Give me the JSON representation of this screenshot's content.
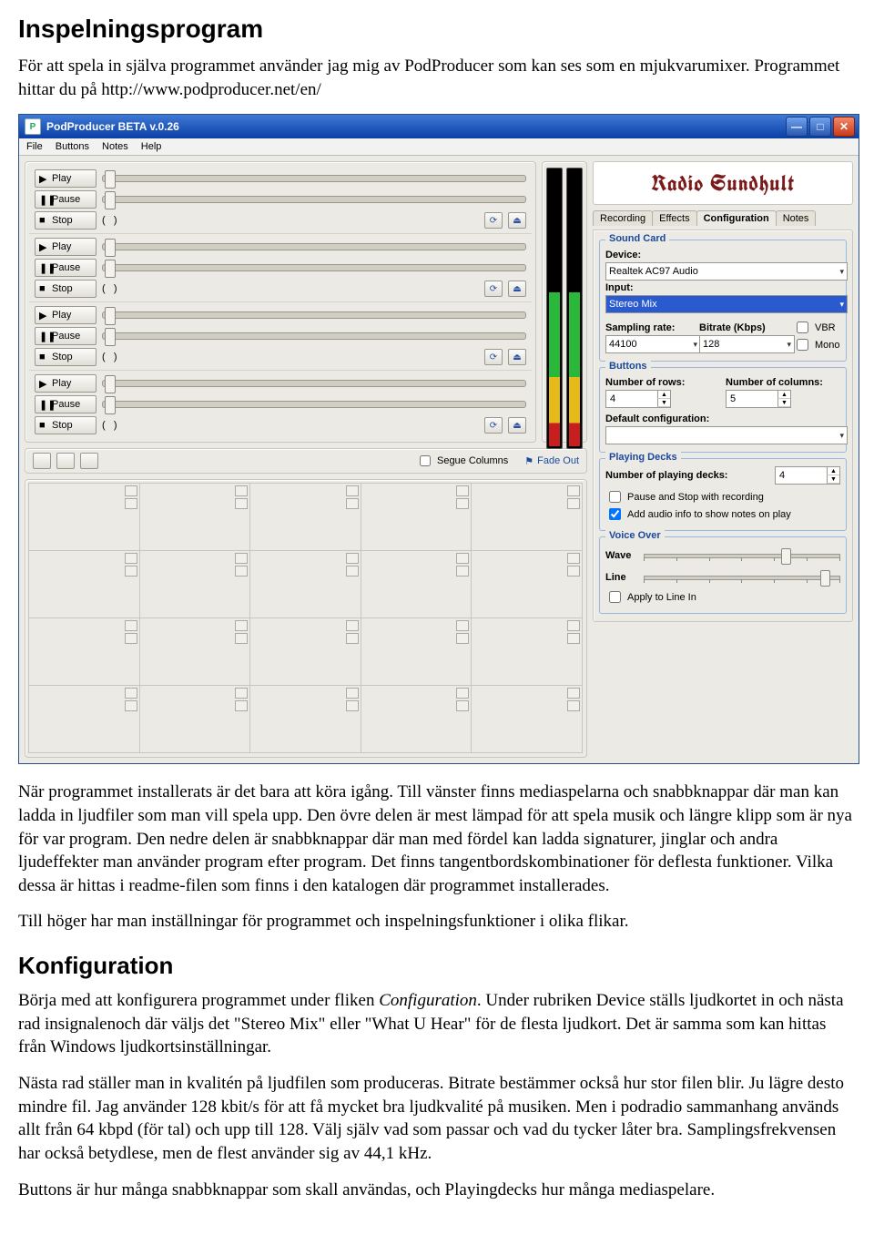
{
  "doc": {
    "h1": "Inspelningsprogram",
    "p1": "För att spela in själva programmet använder jag mig av PodProducer som kan ses som en mjukvarumixer. Programmet hittar du på http://www.podproducer.net/en/",
    "p2": "När programmet installerats är det bara att köra igång. Till vänster finns mediaspelarna och snabbknappar där man kan ladda in ljudfiler som man vill spela upp. Den övre delen är mest lämpad för att spela musik och längre klipp som är nya för var program. Den nedre delen är snabbknappar där man med fördel kan ladda signaturer, jinglar och andra ljudeffekter man använder program efter program. Det finns tangentbordskombinationer för deflesta funktioner. Vilka dessa är hittas i readme-filen som finns i den katalogen där programmet installerades.",
    "p3": "Till höger har man inställningar för programmet och inspelningsfunktioner i olika flikar.",
    "h2": "Konfiguration",
    "p4a": "Börja med att konfigurera programmet under fliken ",
    "p4b": "Configuration",
    "p4c": ". Under rubriken Device ställs ljudkortet in och nästa rad insignalenoch där väljs det \"Stereo Mix\" eller \"What U Hear\" för de flesta ljudkort. Det är samma som kan hittas från Windows ljudkortsinställningar.",
    "p5": "Nästa rad ställer man in kvalitén på ljudfilen som produceras. Bitrate bestämmer också hur stor filen blir. Ju lägre desto mindre fil. Jag använder 128 kbit/s för att få mycket bra ljudkvalité på musiken. Men i podradio sammanhang används allt från 64 kbpd (för tal) och upp till 128. Välj själv vad som passar och vad du tycker låter bra. Samplingsfrekvensen har också betydlese, men de flest använder sig av 44,1 kHz.",
    "p6": "Buttons är hur många snabbknappar som skall användas, och Playingdecks hur många mediaspelare."
  },
  "app": {
    "title": "PodProducer BETA v.0.26",
    "menu": [
      "File",
      "Buttons",
      "Notes",
      "Help"
    ],
    "deck_btns": {
      "play": "Play",
      "pause": "Pause",
      "stop": "Stop"
    },
    "toolbar2": {
      "segue": "Segue Columns",
      "fadeout": "Fade Out"
    },
    "right": {
      "logo": "Radio Sundhult",
      "tabs": [
        "Recording",
        "Effects",
        "Configuration",
        "Notes"
      ],
      "active_tab": 2,
      "sound_card": {
        "title": "Sound Card",
        "device_lbl": "Device:",
        "device_val": "Realtek AC97 Audio",
        "input_lbl": "Input:",
        "input_val": "Stereo Mix",
        "sampling_lbl": "Sampling rate:",
        "sampling_val": "44100",
        "bitrate_lbl": "Bitrate (Kbps)",
        "bitrate_val": "128",
        "vbr": "VBR",
        "mono": "Mono"
      },
      "buttons_grp": {
        "title": "Buttons",
        "rows_lbl": "Number of rows:",
        "rows_val": "4",
        "cols_lbl": "Number of columns:",
        "cols_val": "5",
        "def_lbl": "Default configuration:",
        "def_val": ""
      },
      "decks_grp": {
        "title": "Playing Decks",
        "num_lbl": "Number of playing decks:",
        "num_val": "4",
        "pause_chk": "Pause and Stop with recording",
        "addinfo_chk": "Add audio info to show notes on play"
      },
      "voice_grp": {
        "title": "Voice Over",
        "wave": "Wave",
        "line": "Line",
        "apply": "Apply to Line In"
      }
    }
  }
}
